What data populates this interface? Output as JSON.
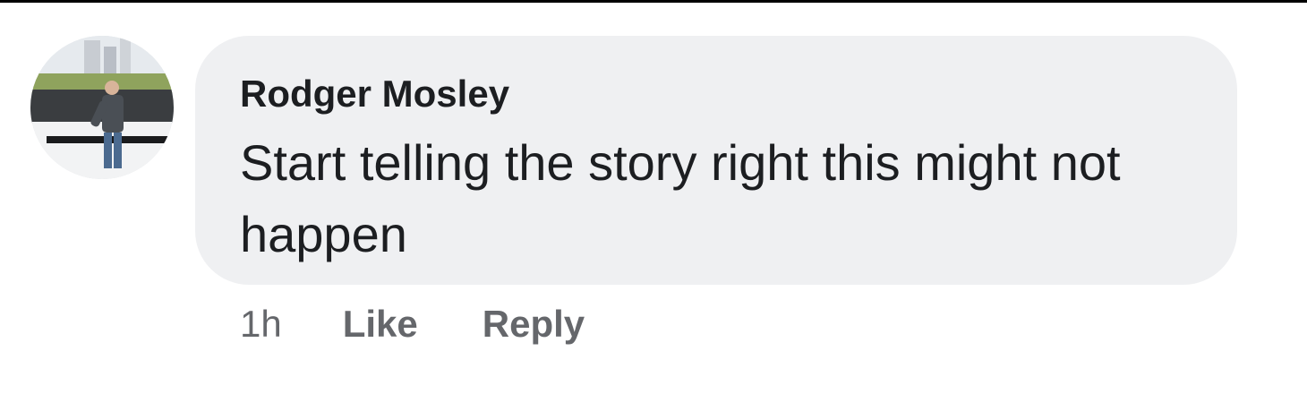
{
  "comment": {
    "author": "Rodger Mosley",
    "text": "Start telling the story right this might not happen",
    "timestamp": "1h",
    "like_label": "Like",
    "reply_label": "Reply"
  },
  "colors": {
    "bubble_background": "#eff0f2",
    "text_primary": "#1c1e21",
    "text_secondary": "#65676b"
  },
  "icons": {
    "avatar": "profile-photo"
  }
}
